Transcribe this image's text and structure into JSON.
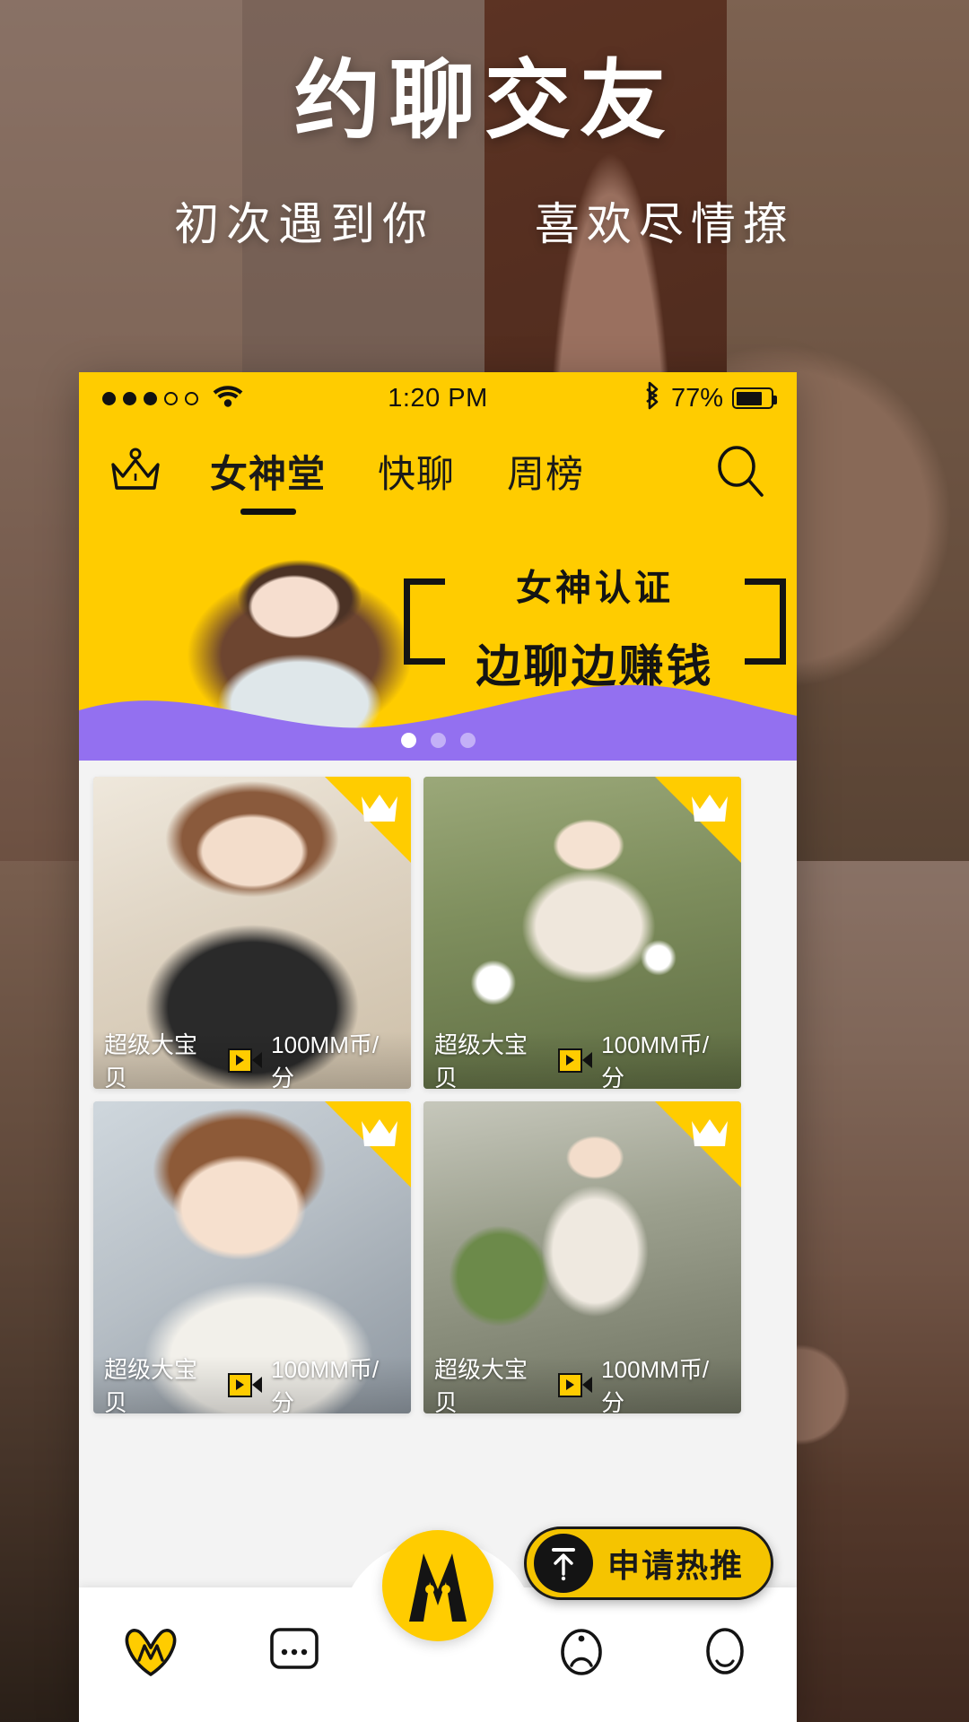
{
  "hero": {
    "title": "约聊交友",
    "subtitle_left": "初次遇到你",
    "subtitle_right": "喜欢尽情撩"
  },
  "colors": {
    "brand_yellow": "#FFCC00",
    "accent_purple": "#9370F0",
    "ink": "#141414",
    "card_bg": "#f3f3f3"
  },
  "statusbar": {
    "signal_filled": 3,
    "signal_empty": 2,
    "wifi_icon": "wifi-icon",
    "time": "1:20 PM",
    "bluetooth_icon": "bluetooth-icon",
    "battery_percent": "77%",
    "battery_level": 77
  },
  "navbar": {
    "crown_icon": "crown-icon",
    "search_icon": "search-icon",
    "tabs": [
      {
        "label": "女神堂",
        "active": true
      },
      {
        "label": "快聊",
        "active": false
      },
      {
        "label": "周榜",
        "active": false
      }
    ]
  },
  "banner": {
    "line1": "女神认证",
    "line2": "边聊边赚钱",
    "dots_total": 3,
    "dots_active_index": 0
  },
  "feed": {
    "cards": [
      {
        "name": "超级大宝贝",
        "price": "100MM币/分",
        "badge_icon": "crown-icon",
        "media_icon": "video-camera-icon"
      },
      {
        "name": "超级大宝贝",
        "price": "100MM币/分",
        "badge_icon": "crown-icon",
        "media_icon": "video-camera-icon"
      },
      {
        "name": "超级大宝贝",
        "price": "100MM币/分",
        "badge_icon": "crown-icon",
        "media_icon": "video-camera-icon"
      },
      {
        "name": "超级大宝贝",
        "price": "100MM币/分",
        "badge_icon": "crown-icon",
        "media_icon": "video-camera-icon"
      }
    ]
  },
  "hotpush": {
    "label": "申请热推",
    "icon": "arrow-up-to-line-icon"
  },
  "tabbar": {
    "items": [
      {
        "label": "",
        "icon": "mm-heart-icon",
        "active": true
      },
      {
        "label": "",
        "icon": "chat-bubble-icon",
        "active": false
      },
      {
        "label": "",
        "icon": "mm-logo-icon",
        "active": false
      },
      {
        "label": "",
        "icon": "compass-icon",
        "active": false
      },
      {
        "label": "",
        "icon": "profile-icon",
        "active": false
      }
    ],
    "center_icon": "mm-logo-icon"
  }
}
